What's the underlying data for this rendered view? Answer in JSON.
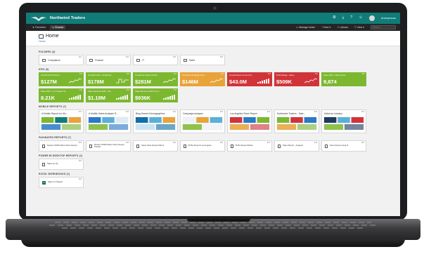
{
  "app": {
    "title": "Northwind Traders"
  },
  "topbar": {
    "icons": [
      "gear-icon",
      "download-icon",
      "help-icon",
      "smiley-icon"
    ],
    "user": "Anonymous"
  },
  "toolbar": {
    "tabs": [
      "Favorites",
      "Browse"
    ],
    "actions": [
      "Manage folder",
      "New",
      "Upload",
      "View"
    ],
    "search_placeholder": "Search"
  },
  "header": {
    "title": "Home",
    "breadcrumb": "Home"
  },
  "sections": {
    "folders": {
      "title": "FOLDERS (4)",
      "items": [
        "Compliance",
        "Finance",
        "IT",
        "Sales"
      ]
    },
    "kpis": {
      "title": "KPIs (9)",
      "items": [
        {
          "title": "Overall Profit Perform...",
          "value": "$127M",
          "color": "#7cb82f",
          "chart": "line"
        },
        {
          "title": "Overall COGS - Northwind...",
          "value": "$178M",
          "color": "#7cb82f",
          "chart": "step"
        },
        {
          "title": "Overall Net Sales Northw...",
          "value": "$281M",
          "color": "#7cb82f",
          "chart": "line"
        },
        {
          "title": "Overall Profit Margin Perf...",
          "value": "$146M",
          "color": "#e8a33a",
          "chart": "line"
        },
        {
          "title": "Overall Return Amount Pr...",
          "value": "$43.0M",
          "color": "#d13438",
          "chart": "bars"
        },
        {
          "title": "Profit Margin - Mass...",
          "value": "$509K",
          "color": "#d13438",
          "chart": "line"
        },
        {
          "title": "Sales 2015 - Miami Store",
          "value": "9,874",
          "color": "#7cb82f",
          "chart": "none"
        },
        {
          "title": "Sales 2015 - Los Angeles St...",
          "value": "8.21K",
          "color": "#7cb82f",
          "chart": "bars"
        },
        {
          "title": "Sales Revenue 2015 - Ma...",
          "value": "$1.18M",
          "color": "#7cb82f",
          "chart": "bars"
        },
        {
          "title": "Sales Revenue 2015 Los A...",
          "value": "$936K",
          "color": "#7cb82f",
          "chart": "bars"
        }
      ]
    },
    "mobile_reports": {
      "title": "MOBILE REPORTS (7)",
      "items": [
        "A Mobile Report for Mo...",
        "A Mobile Sales Analysis R...",
        "Bing Search Demographics",
        "Campaign analysis",
        "Los Angeles Store Report",
        "Northwind Traders - Sale...",
        "Sales by Industry"
      ]
    },
    "paginated_reports": {
      "title": "PAGINATED REPORTS (7)",
      "items": [
        "Modern SSRS Miami Store Report",
        "Modern SSRS Miami Store Report Portrait",
        "Glass Store Report Miami",
        "B Plot Report Los Angeles",
        "B Plot Report Miami",
        "Sales Report - Analysis",
        "Store Report using R"
      ]
    },
    "power_bi": {
      "title": "POWER BI DESKTOP REPORTS (1)",
      "items": [
        "Sales by city"
      ]
    },
    "excel": {
      "title": "EXCEL WORKBOOKS (1)",
      "items": [
        "Sales Vs Targets"
      ]
    }
  }
}
